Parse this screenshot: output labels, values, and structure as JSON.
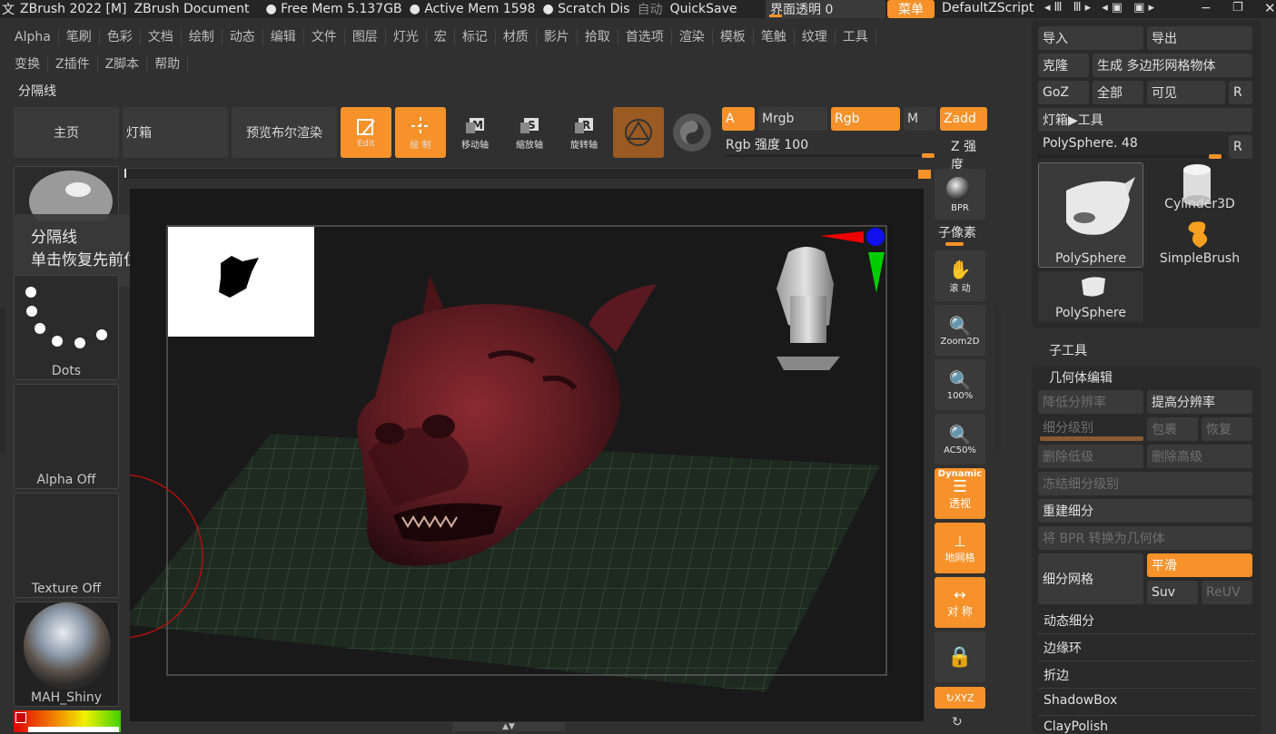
{
  "title": {
    "app": "ZBrush 2022 [M]",
    "doc": "ZBrush Document",
    "freemem": "● Free Mem 5.137GB",
    "activemem": "● Active Mem 1598",
    "scratch": "● Scratch Dis",
    "auto": "自动",
    "quicksave": "QuickSave",
    "transparency": "界面透明 0",
    "menu_btn": "菜单",
    "script": "DefaultZScript"
  },
  "menus_row1": [
    "Alpha",
    "笔刷",
    "色彩",
    "文档",
    "绘制",
    "动态",
    "编辑",
    "文件",
    "图层",
    "灯光",
    "宏",
    "标记",
    "材质",
    "影片",
    "拾取",
    "首选项",
    "渲染",
    "模板",
    "笔触",
    "纹理",
    "工具"
  ],
  "menus_row2": [
    "变换",
    "Z插件",
    "Z脚本",
    "帮助"
  ],
  "section_label": "分隔线",
  "toolbar": {
    "home": "主页",
    "lightbox": "灯箱",
    "bpr": "预览布尔渲染",
    "edit": "Edit",
    "draw": "绘 制",
    "move": "移动轴",
    "scale": "缩放轴",
    "rotate": "旋转轴",
    "a": "A",
    "mrgb": "Mrgb",
    "rgb": "Rgb",
    "m": "M",
    "zadd": "Zadd",
    "rgb_intensity": "Rgb 强度 100",
    "z_intensity": "Z 强度"
  },
  "tooltip": {
    "title": "分隔线",
    "body": "单击恢复先前位置。"
  },
  "left": {
    "dots": "Dots",
    "alpha": "Alpha Off",
    "texture": "Texture Off",
    "material": "MAH_Shiny"
  },
  "right_tools": {
    "bpr": "BPR",
    "subpixel": "子像素",
    "scroll": "滚 动",
    "zoom2d": "Zoom2D",
    "pct100": "100%",
    "ac50": "AC50%",
    "dynamic": "Dynamic",
    "persp": "透视",
    "floor": "地网格",
    "sym": "对 称",
    "xyz": "XYZ"
  },
  "panel": {
    "import": "导入",
    "export": "导出",
    "clone": "克隆",
    "make_polymesh": "生成 多边形网格物体",
    "goz": "GoZ",
    "all": "全部",
    "visible": "可见",
    "r": "R",
    "lightbox_tool": "灯箱▶工具",
    "polysphere48": "PolySphere. 48",
    "tools": [
      "PolySphere",
      "Cylinder3D",
      "SimpleBrush",
      "PolySphere"
    ],
    "subtool": "子工具",
    "geometry": "几何体编辑",
    "lower_res": "降低分辨率",
    "higher_res": "提高分辨率",
    "sdiv": "细分级别",
    "reproject": "包裹",
    "restore": "恢复",
    "del_lower": "删除低级",
    "del_higher": "删除高级",
    "freeze": "冻结细分级别",
    "reconstruct": "重建细分",
    "bpr_to_geo": "将 BPR 转换为几何体",
    "divide": "细分网格",
    "smooth": "平滑",
    "suv": "Suv",
    "reuv": "ReUV",
    "dynamic_sub": "动态细分",
    "edgeloop": "边缘环",
    "crease": "折边",
    "shadowbox": "ShadowBox",
    "claypolish": "ClayPolish"
  },
  "colors": {
    "accent": "#f7922b",
    "bg": "#303030"
  }
}
